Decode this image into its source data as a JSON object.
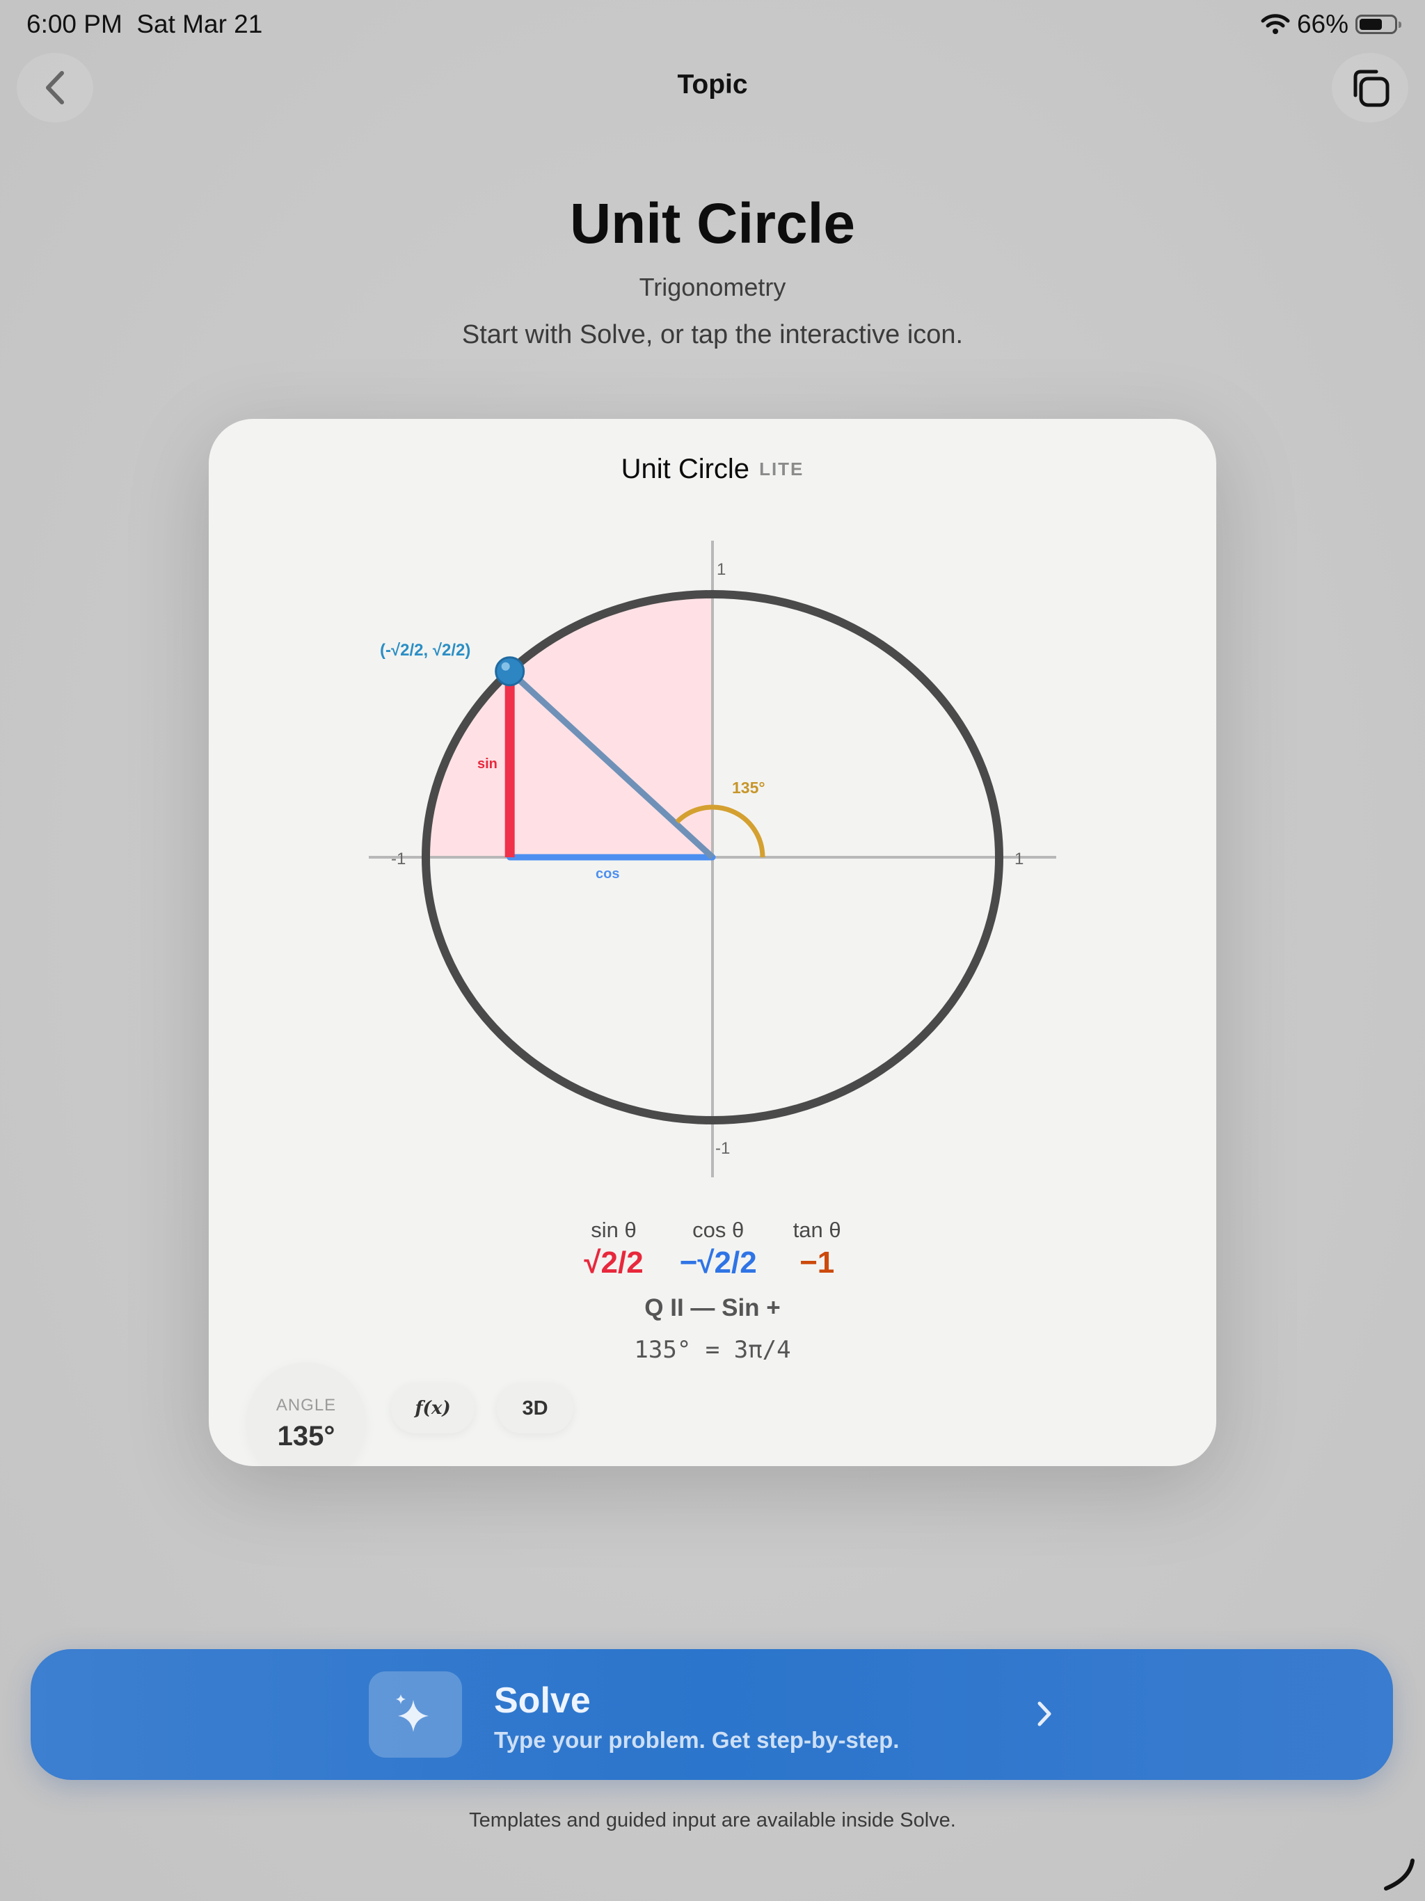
{
  "status": {
    "time": "6:00 PM",
    "date": "Sat Mar 21",
    "battery": "66%",
    "battery_level": 0.66
  },
  "nav": {
    "title": "Topic"
  },
  "header": {
    "title": "Unit Circle",
    "subtitle": "Trigonometry",
    "hint": "Start with Solve, or tap the interactive icon."
  },
  "card": {
    "title": "Unit Circle",
    "badge": "LITE",
    "diagram": {
      "angle_deg": 135,
      "point_label": "(-√2/2, √2/2)",
      "angle_label": "135°",
      "sin_label": "sin",
      "cos_label": "cos",
      "axis_top": "1",
      "axis_bottom": "-1",
      "axis_left": "-1",
      "axis_right": "1"
    },
    "values": [
      {
        "label": "sin θ",
        "value": "√2/2",
        "color": "#e8283c"
      },
      {
        "label": "cos θ",
        "value": "−√2/2",
        "color": "#2f74e6"
      },
      {
        "label": "tan θ",
        "value": "−1",
        "color": "#cc4a0c"
      }
    ],
    "quadrant": "Q II — Sin +",
    "conversion": "135° = 3π/4",
    "angle_chip": {
      "label": "ANGLE",
      "value": "135°"
    },
    "fx_button": "f(x)",
    "threed_button": "3D"
  },
  "solve": {
    "title": "Solve",
    "subtitle": "Type your problem. Get step-by-step."
  },
  "footnote": "Templates and guided input are available inside Solve.",
  "colors": {
    "accent": "#2b75cc",
    "sin": "#f0314a",
    "cos": "#4d8ff0",
    "hypotenuse": "#6f91b8",
    "arc": "#d4a030",
    "point": "#2d85c2",
    "sector_fill": "#ffdfe4"
  },
  "icons": {
    "back": "chevron-left-icon",
    "copy": "copy-icon",
    "wifi": "wifi-icon",
    "battery": "battery-icon",
    "solve": "sparkles-icon",
    "chevron": "chevron-right-icon",
    "spinner": "spinner-icon"
  }
}
